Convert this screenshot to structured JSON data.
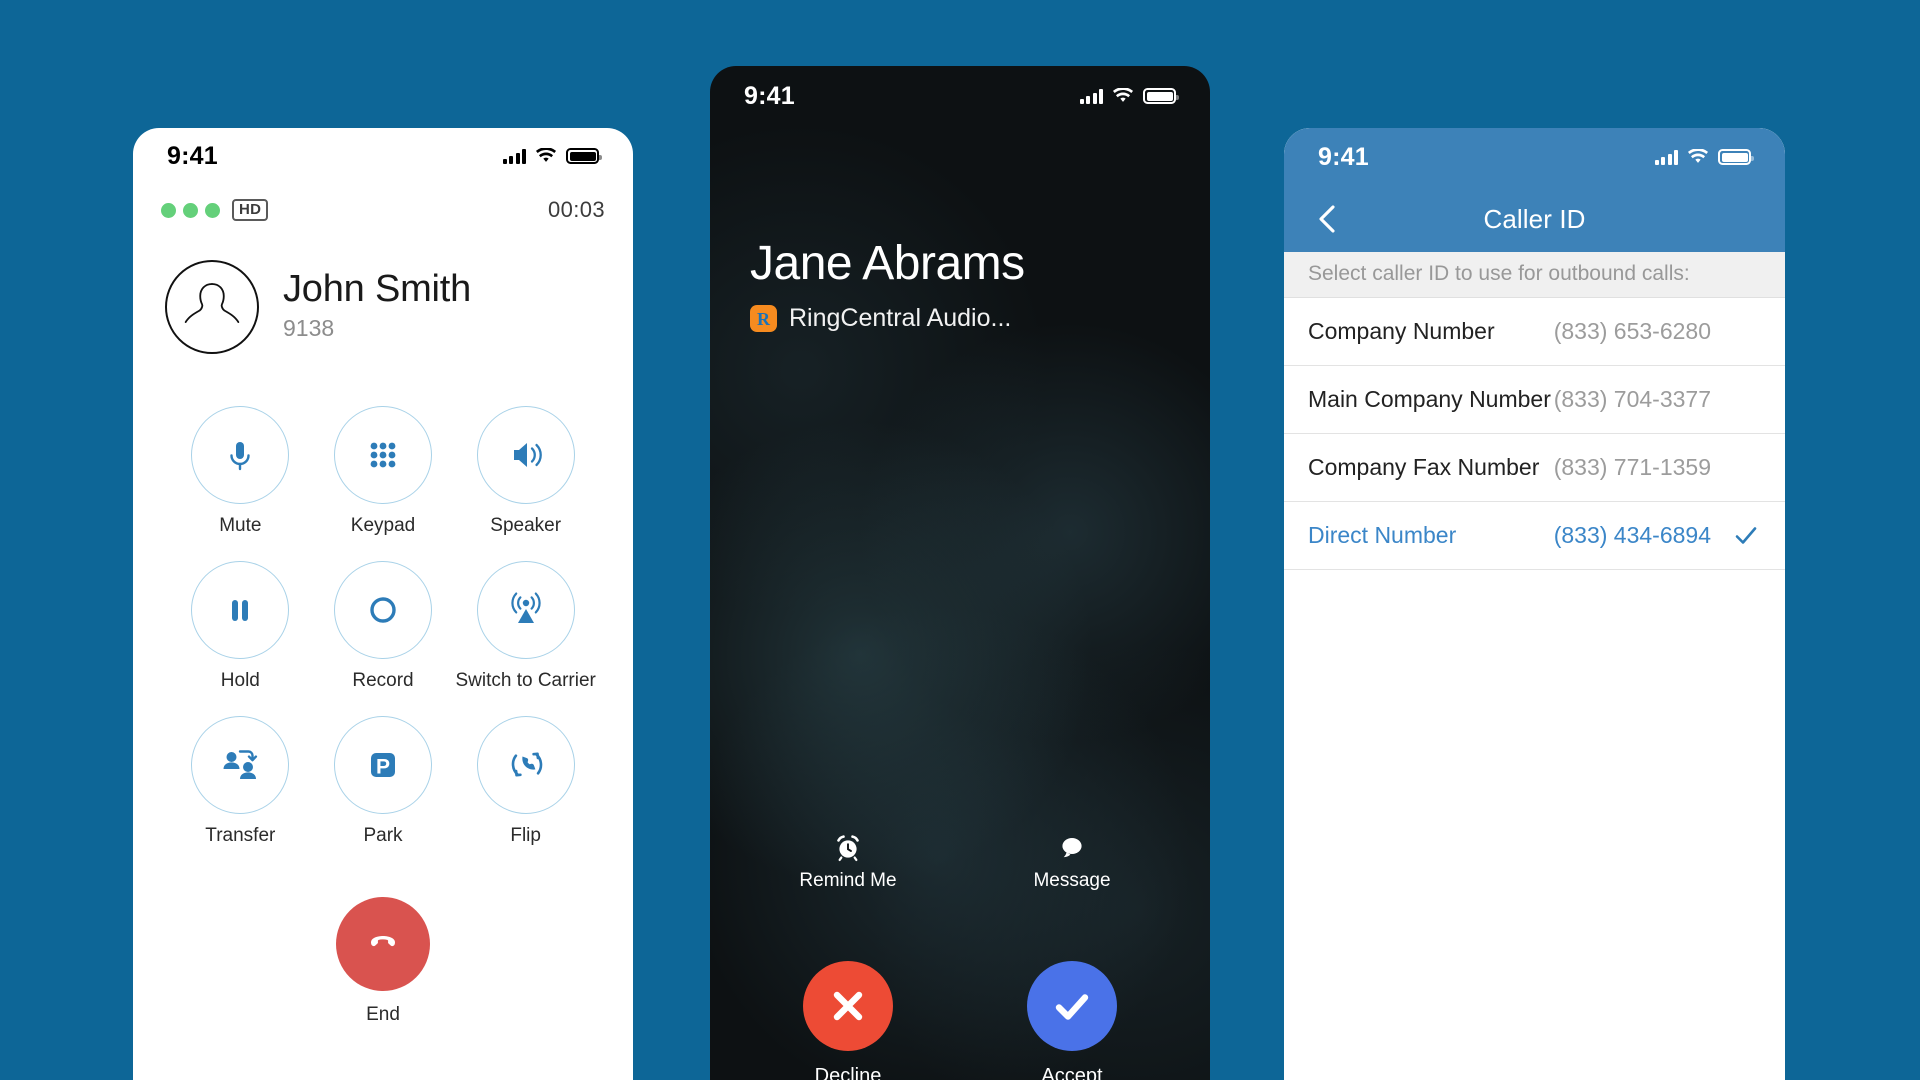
{
  "background_color": "#0d6697",
  "active_call": {
    "status_bar": {
      "time": "9:41"
    },
    "quality_badge": "HD",
    "timer": "00:03",
    "contact_name": "John Smith",
    "contact_extension": "9138",
    "controls": [
      {
        "label": "Mute",
        "icon": "microphone-icon"
      },
      {
        "label": "Keypad",
        "icon": "keypad-icon"
      },
      {
        "label": "Speaker",
        "icon": "speaker-icon"
      },
      {
        "label": "Hold",
        "icon": "pause-icon"
      },
      {
        "label": "Record",
        "icon": "record-icon"
      },
      {
        "label": "Switch to Carrier",
        "icon": "broadcast-icon"
      },
      {
        "label": "Transfer",
        "icon": "transfer-icon"
      },
      {
        "label": "Park",
        "icon": "park-icon"
      },
      {
        "label": "Flip",
        "icon": "flip-icon"
      }
    ],
    "end_label": "End",
    "end_color": "#d9534f",
    "accent_color": "#2d7cb8"
  },
  "incoming_call": {
    "status_bar": {
      "time": "9:41"
    },
    "caller_name": "Jane Abrams",
    "app_label": "RingCentral Audio...",
    "app_logo_color": "#f68b1f",
    "secondary_actions": [
      {
        "label": "Remind Me",
        "icon": "alarm-clock-icon"
      },
      {
        "label": "Message",
        "icon": "chat-bubble-icon"
      }
    ],
    "primary_actions": [
      {
        "label": "Decline",
        "icon": "close-x-icon",
        "color": "#ed4b35"
      },
      {
        "label": "Accept",
        "icon": "checkmark-icon",
        "color": "#4a72e8"
      }
    ]
  },
  "caller_id": {
    "status_bar": {
      "time": "9:41"
    },
    "title": "Caller ID",
    "back_icon": "chevron-left-icon",
    "header_color": "#3d82b8",
    "subheader": "Select caller ID to use for outbound calls:",
    "rows": [
      {
        "name": "Company Number",
        "number": "(833) 653-6280",
        "selected": false
      },
      {
        "name": "Main Company Number",
        "number": "(833) 704-3377",
        "selected": false
      },
      {
        "name": "Company Fax Number",
        "number": "(833) 771-1359",
        "selected": false
      },
      {
        "name": "Direct Number",
        "number": "(833) 434-6894",
        "selected": true
      }
    ]
  }
}
